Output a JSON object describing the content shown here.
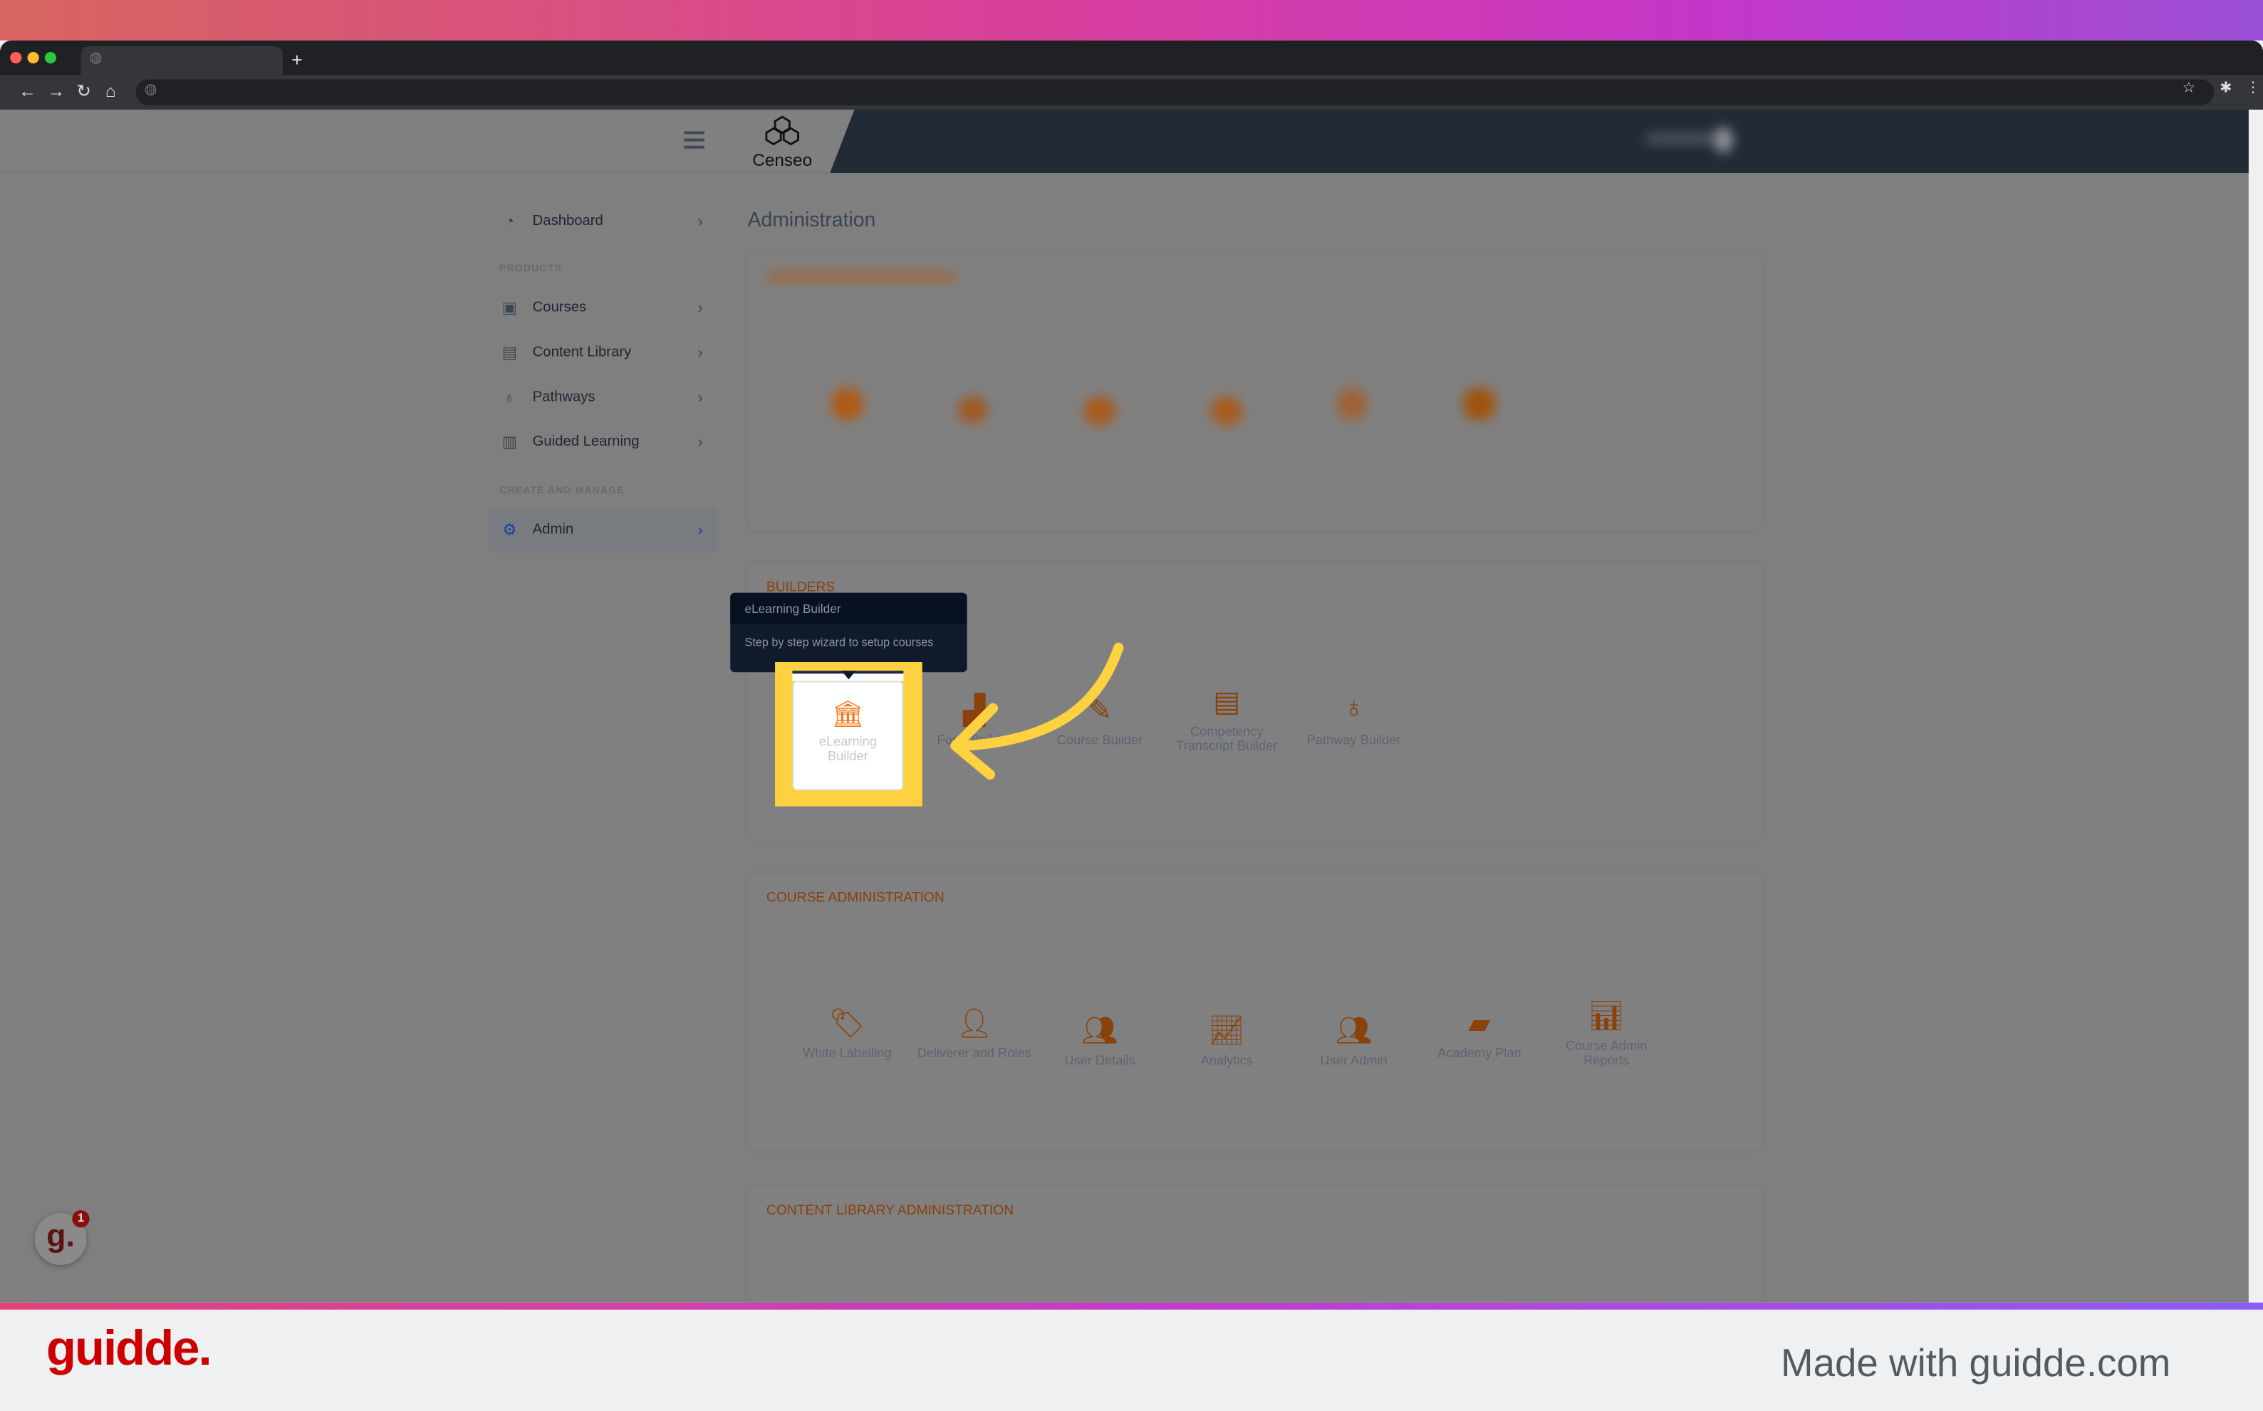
{
  "browser": {
    "new_tab": "+",
    "icons": [
      "back-icon",
      "forward-icon",
      "reload-icon",
      "home-icon",
      "star-icon",
      "extensions-icon",
      "menu-icon"
    ]
  },
  "header": {
    "logo_text": "Censeo"
  },
  "sidebar": {
    "items": [
      {
        "label": "Dashboard",
        "icon": "dashboard-icon"
      },
      {
        "section": "PRODUCTS"
      },
      {
        "label": "Courses",
        "icon": "courses-icon"
      },
      {
        "label": "Content Library",
        "icon": "book-icon"
      },
      {
        "label": "Pathways",
        "icon": "award-icon"
      },
      {
        "label": "Guided Learning",
        "icon": "clipboard-icon"
      },
      {
        "section": "CREATE AND MANAGE"
      },
      {
        "label": "Admin",
        "icon": "gear-icon",
        "active": true
      }
    ],
    "dashboard": "Dashboard",
    "products": "PRODUCTS",
    "courses": "Courses",
    "content_library": "Content Library",
    "pathways": "Pathways",
    "guided_learning": "Guided Learning",
    "create_manage": "CREATE AND MANAGE",
    "admin": "Admin"
  },
  "main": {
    "title": "Administration",
    "builders": {
      "title": "BUILDERS",
      "tiles": [
        "eLearning Builder",
        "Form Builder",
        "Course Builder",
        "Competency Transcript Builder",
        "Pathway Builder"
      ]
    },
    "tooltip": {
      "title": "eLearning Builder",
      "body": "Step by step wizard to setup courses"
    },
    "course_admin": {
      "title": "COURSE ADMINISTRATION",
      "tiles": [
        "White Labelling",
        "Deliverer and Roles",
        "User Details",
        "Analytics",
        "User Admin",
        "Academy Plan",
        "Course Admin Reports"
      ]
    },
    "content_admin": {
      "title": "CONTENT LIBRARY ADMINISTRATION"
    }
  },
  "colors": {
    "accent": "#f47a20",
    "highlight": "#fed141",
    "brand": "#cc0000",
    "header_dark": "#222a35"
  },
  "footer": {
    "logo": "guidde.",
    "made_with": "Made with guidde.com",
    "badge_count": "1"
  }
}
